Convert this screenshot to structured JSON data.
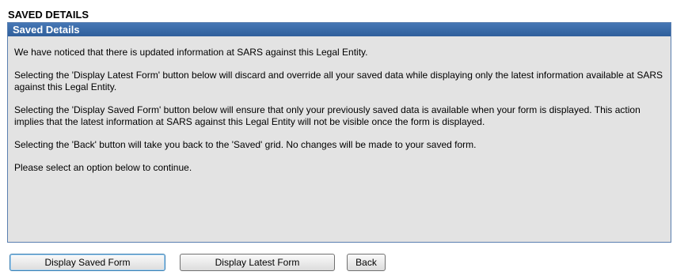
{
  "page": {
    "heading": "SAVED DETAILS"
  },
  "panel": {
    "title": "Saved Details",
    "paragraphs": [
      "We have noticed that there is updated information at SARS against this Legal Entity.",
      "Selecting the 'Display Latest Form' button below will discard and override all your saved data while displaying only the latest information available at SARS against this Legal Entity.",
      "Selecting the 'Display Saved Form' button below will ensure that only your previously saved data is available when your form is displayed. This action implies that the latest information at SARS against this Legal Entity will not be visible once the form is displayed.",
      "Selecting the 'Back' button will take you back to the 'Saved' grid. No changes will be made to your saved form.",
      "Please select an option below to continue."
    ]
  },
  "buttons": {
    "display_saved": "Display Saved Form",
    "display_latest": "Display Latest Form",
    "back": "Back"
  },
  "colors": {
    "panel_header": "#3a6aa6",
    "panel_background": "#e3e3e3",
    "panel_border": "#5a7fb0"
  }
}
